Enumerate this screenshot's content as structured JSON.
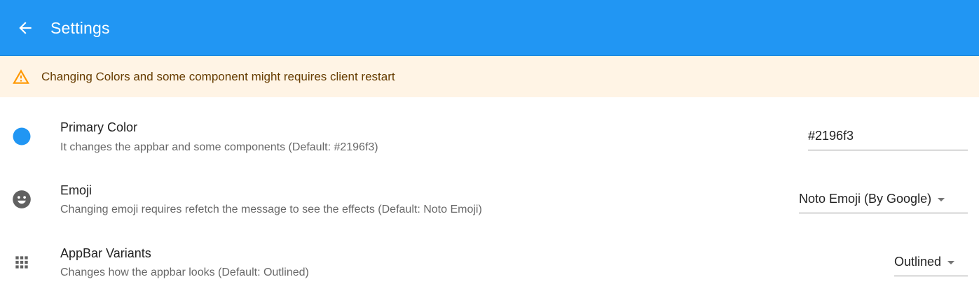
{
  "appbar": {
    "title": "Settings",
    "back_icon": "arrow-back-icon",
    "background": "#2196f3"
  },
  "banner": {
    "icon": "warning-icon",
    "text": "Changing Colors and some component might requires client restart",
    "background": "#fff4e5",
    "icon_color": "#ff9800"
  },
  "settings": [
    {
      "icon": "color-circle-icon",
      "icon_color": "#2196f3",
      "title": "Primary Color",
      "description": "It changes the appbar and some components (Default: #2196f3)",
      "control": "text",
      "value": "#2196f3"
    },
    {
      "icon": "emoji-icon",
      "title": "Emoji",
      "description": "Changing emoji requires refetch the message to see the effects (Default: Noto Emoji)",
      "control": "select",
      "value": "Noto Emoji (By Google)"
    },
    {
      "icon": "apps-grid-icon",
      "title": "AppBar Variants",
      "description": "Changes how the appbar looks (Default: Outlined)",
      "control": "select",
      "value": "Outlined"
    }
  ]
}
